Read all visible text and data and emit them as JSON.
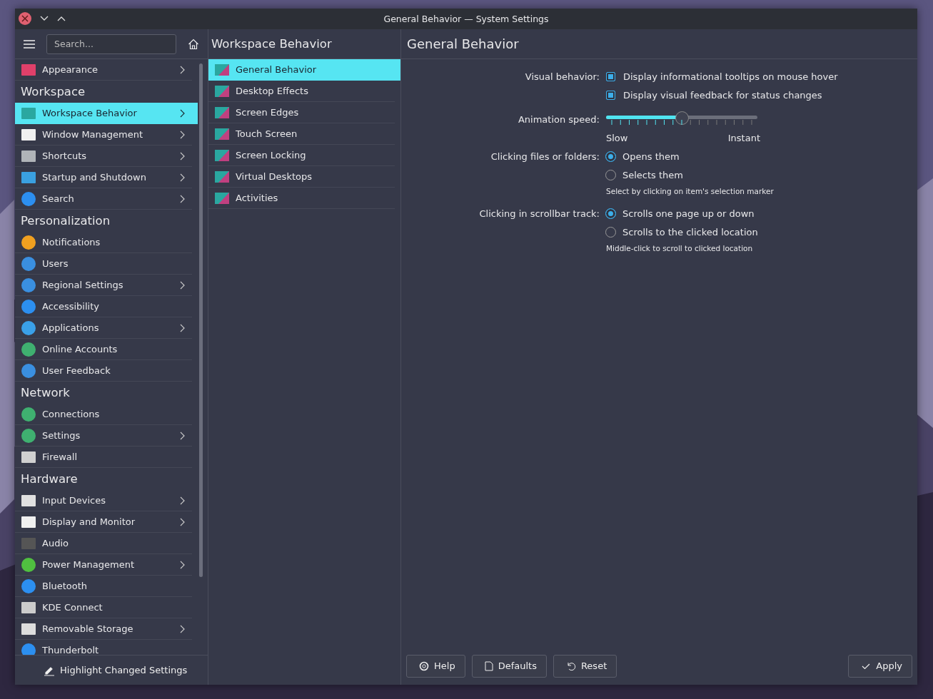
{
  "window": {
    "title": "General Behavior — System Settings"
  },
  "search": {
    "placeholder": "Search..."
  },
  "sidebar": {
    "sections": [
      {
        "items": [
          {
            "label": "Appearance",
            "has_children": true,
            "selected": false
          }
        ]
      },
      {
        "heading": "Workspace",
        "items": [
          {
            "label": "Workspace Behavior",
            "has_children": true,
            "selected": true
          },
          {
            "label": "Window Management",
            "has_children": true,
            "selected": false
          },
          {
            "label": "Shortcuts",
            "has_children": true,
            "selected": false
          },
          {
            "label": "Startup and Shutdown",
            "has_children": true,
            "selected": false
          },
          {
            "label": "Search",
            "has_children": true,
            "selected": false
          }
        ]
      },
      {
        "heading": "Personalization",
        "items": [
          {
            "label": "Notifications",
            "has_children": false,
            "selected": false
          },
          {
            "label": "Users",
            "has_children": false,
            "selected": false
          },
          {
            "label": "Regional Settings",
            "has_children": true,
            "selected": false
          },
          {
            "label": "Accessibility",
            "has_children": false,
            "selected": false
          },
          {
            "label": "Applications",
            "has_children": true,
            "selected": false
          },
          {
            "label": "Online Accounts",
            "has_children": false,
            "selected": false
          },
          {
            "label": "User Feedback",
            "has_children": false,
            "selected": false
          }
        ]
      },
      {
        "heading": "Network",
        "items": [
          {
            "label": "Connections",
            "has_children": false,
            "selected": false
          },
          {
            "label": "Settings",
            "has_children": true,
            "selected": false
          },
          {
            "label": "Firewall",
            "has_children": false,
            "selected": false
          }
        ]
      },
      {
        "heading": "Hardware",
        "items": [
          {
            "label": "Input Devices",
            "has_children": true,
            "selected": false
          },
          {
            "label": "Display and Monitor",
            "has_children": true,
            "selected": false
          },
          {
            "label": "Audio",
            "has_children": false,
            "selected": false
          },
          {
            "label": "Power Management",
            "has_children": true,
            "selected": false
          },
          {
            "label": "Bluetooth",
            "has_children": false,
            "selected": false
          },
          {
            "label": "KDE Connect",
            "has_children": false,
            "selected": false
          },
          {
            "label": "Removable Storage",
            "has_children": true,
            "selected": false
          },
          {
            "label": "Thunderbolt",
            "has_children": false,
            "selected": false
          }
        ]
      }
    ]
  },
  "highlight_button": "Highlight Changed Settings",
  "subpanel": {
    "title": "Workspace Behavior",
    "items": [
      {
        "label": "General Behavior",
        "selected": true
      },
      {
        "label": "Desktop Effects",
        "selected": false
      },
      {
        "label": "Screen Edges",
        "selected": false
      },
      {
        "label": "Touch Screen",
        "selected": false
      },
      {
        "label": "Screen Locking",
        "selected": false
      },
      {
        "label": "Virtual Desktops",
        "selected": false
      },
      {
        "label": "Activities",
        "selected": false
      }
    ]
  },
  "page": {
    "title": "General Behavior",
    "rows": [
      {
        "kind": "checks",
        "label": "Visual behavior:",
        "options": [
          {
            "label": "Display informational tooltips on mouse hover",
            "checked": true
          },
          {
            "label": "Display visual feedback for status changes",
            "checked": true
          }
        ]
      },
      {
        "kind": "slider",
        "label": "Animation speed:",
        "level": 0.5,
        "min_label": "Slow",
        "max_label": "Instant"
      },
      {
        "kind": "radios",
        "label": "Clicking files or folders:",
        "options": [
          {
            "label": "Opens them",
            "selected": true
          },
          {
            "label": "Selects them",
            "selected": false
          }
        ],
        "hint": "Select by clicking on item's selection marker"
      },
      {
        "kind": "radios",
        "label": "Clicking in scrollbar track:",
        "options": [
          {
            "label": "Scrolls one page up or down",
            "selected": true
          },
          {
            "label": "Scrolls to the clicked location",
            "selected": false
          }
        ],
        "hint": "Middle-click to scroll to clicked location"
      }
    ]
  },
  "buttons": [
    {
      "kind": "help",
      "label": "Help"
    },
    {
      "kind": "defaults",
      "label": "Defaults"
    },
    {
      "kind": "reset",
      "label": "Reset"
    },
    {
      "kind": "apply",
      "label": "Apply"
    }
  ]
}
